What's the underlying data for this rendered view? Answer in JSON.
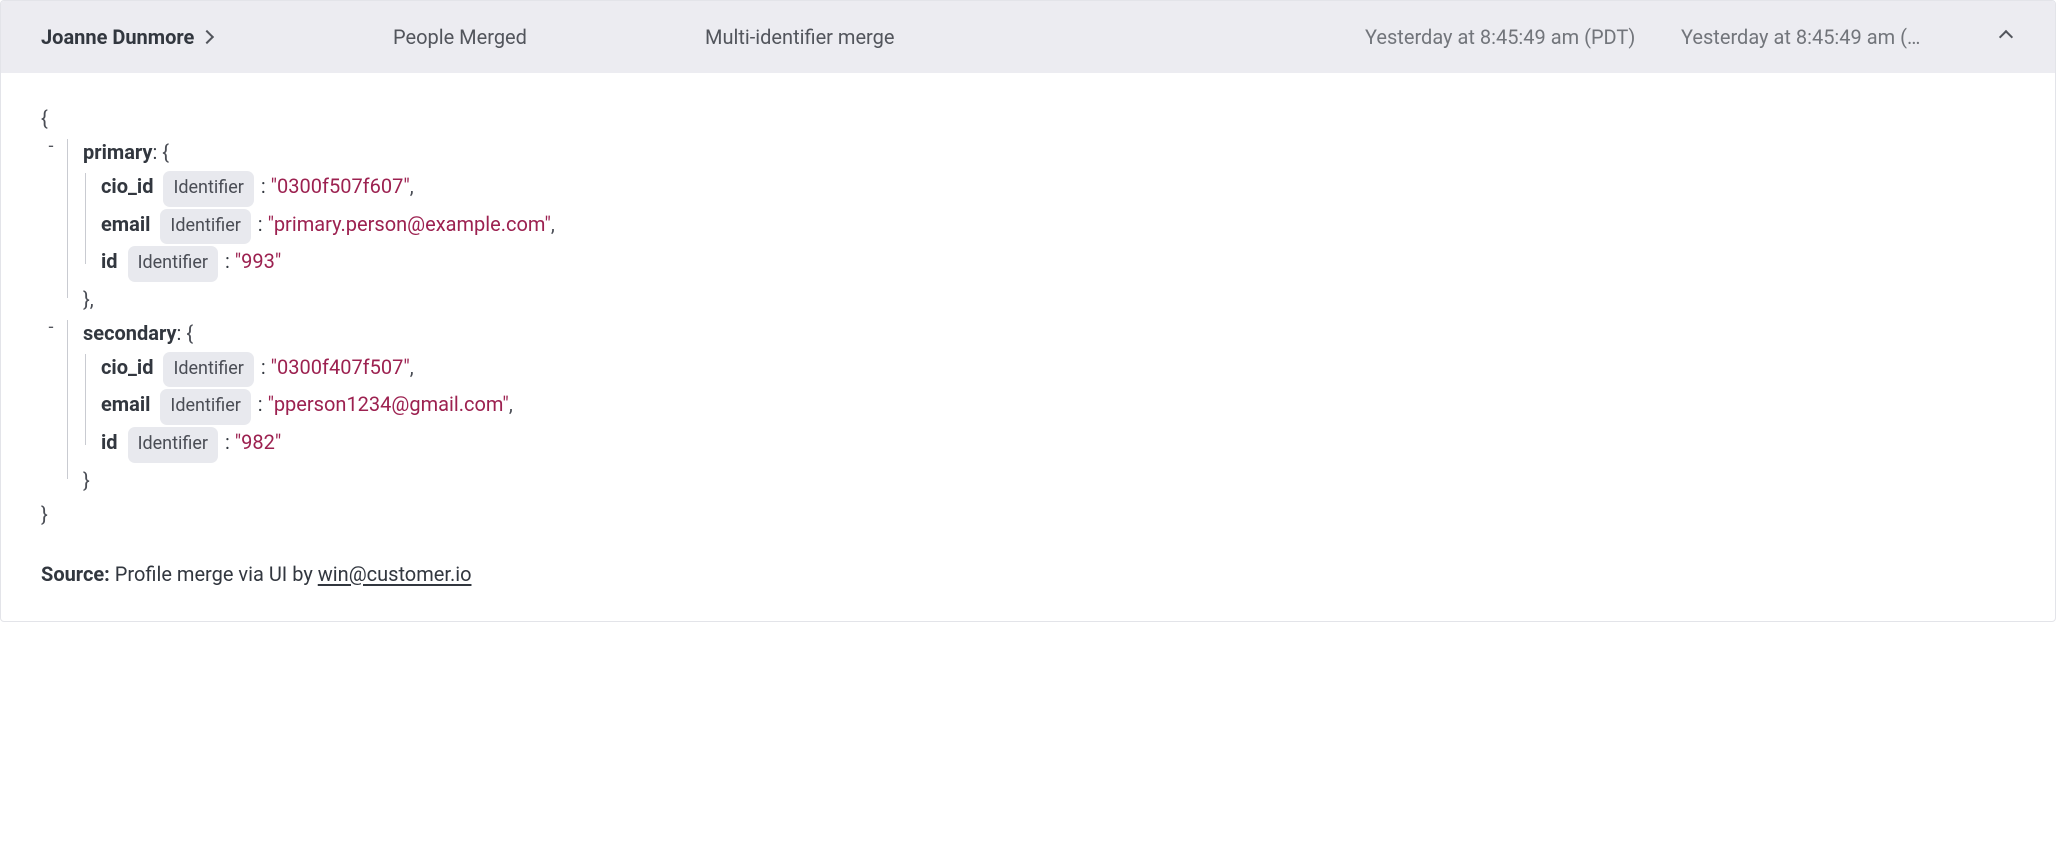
{
  "header": {
    "name": "Joanne Dunmore",
    "event": "People Merged",
    "subtype": "Multi-identifier merge",
    "ts1": "Yesterday at 8:45:49 am (PDT)",
    "ts2": "Yesterday at 8:45:49 am (…"
  },
  "identifier_label": "Identifier",
  "json": {
    "primary": {
      "cio_id": "0300f507f607",
      "email": "primary.person@example.com",
      "id": "993"
    },
    "secondary": {
      "cio_id": "0300f407f507",
      "email": "pperson1234@gmail.com",
      "id": "982"
    }
  },
  "source": {
    "label": "Source:",
    "text": "Profile merge via UI by ",
    "email": "win@customer.io"
  }
}
